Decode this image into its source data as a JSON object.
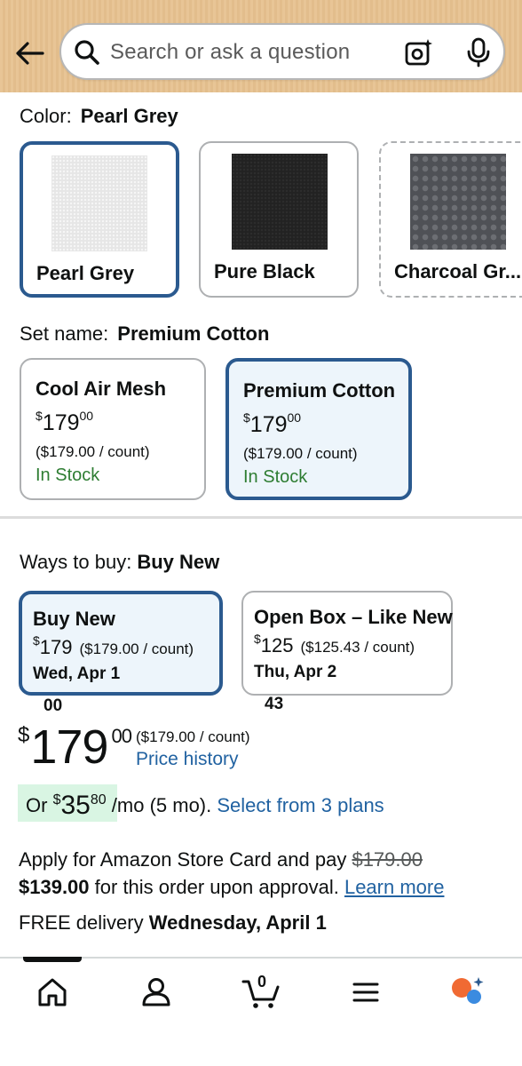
{
  "search": {
    "placeholder": "Search or ask a question"
  },
  "color": {
    "label": "Color:",
    "selected": "Pearl Grey",
    "options": [
      {
        "name": "Pearl Grey",
        "selected": true
      },
      {
        "name": "Pure Black",
        "selected": false
      },
      {
        "name": "Charcoal Gr...",
        "selected": false
      }
    ]
  },
  "set": {
    "label": "Set name:",
    "selected": "Premium Cotton",
    "options": [
      {
        "title": "Cool Air Mesh",
        "dollars": "179",
        "cents": "00",
        "unit": "($179.00 / count)",
        "stock": "In Stock",
        "selected": false
      },
      {
        "title": "Premium Cotton",
        "dollars": "179",
        "cents": "00",
        "unit": "($179.00 / count)",
        "stock": "In Stock",
        "selected": true
      }
    ]
  },
  "ways": {
    "label": "Ways to buy:",
    "selected": "Buy New",
    "options": [
      {
        "title": "Buy New",
        "dollars": "179",
        "cents": "00",
        "unit": "($179.00 / count)",
        "date": "Wed, Apr 1",
        "selected": true
      },
      {
        "title": "Open Box – Like New",
        "dollars": "125",
        "cents": "43",
        "unit": "($125.43 / count)",
        "date": "Thu, Apr 2",
        "selected": false
      }
    ]
  },
  "price": {
    "currency": "$",
    "dollars": "179",
    "cents": "00",
    "unit": "($179.00 / count)",
    "history_link": "Price history"
  },
  "monthly": {
    "prefix": "Or",
    "currency": "$",
    "dollars": "35",
    "cents": "80",
    "suffix": "/mo (5 mo).",
    "link": "Select from 3 plans"
  },
  "store_card": {
    "text1": "Apply for Amazon Store Card and pay",
    "old_price": "$179.00",
    "new_price": "$139.00",
    "text2": "for this order upon approval.",
    "link": "Learn more"
  },
  "delivery": {
    "prefix": "FREE delivery",
    "date": "Wednesday, April 1"
  },
  "cart": {
    "count": "0"
  },
  "colors": {
    "accent": "#2b5a8f",
    "link": "#2162a1",
    "stock": "#2e7d32",
    "selected_bg": "#edf5fb",
    "monthly_bg": "#d9f5e3"
  }
}
